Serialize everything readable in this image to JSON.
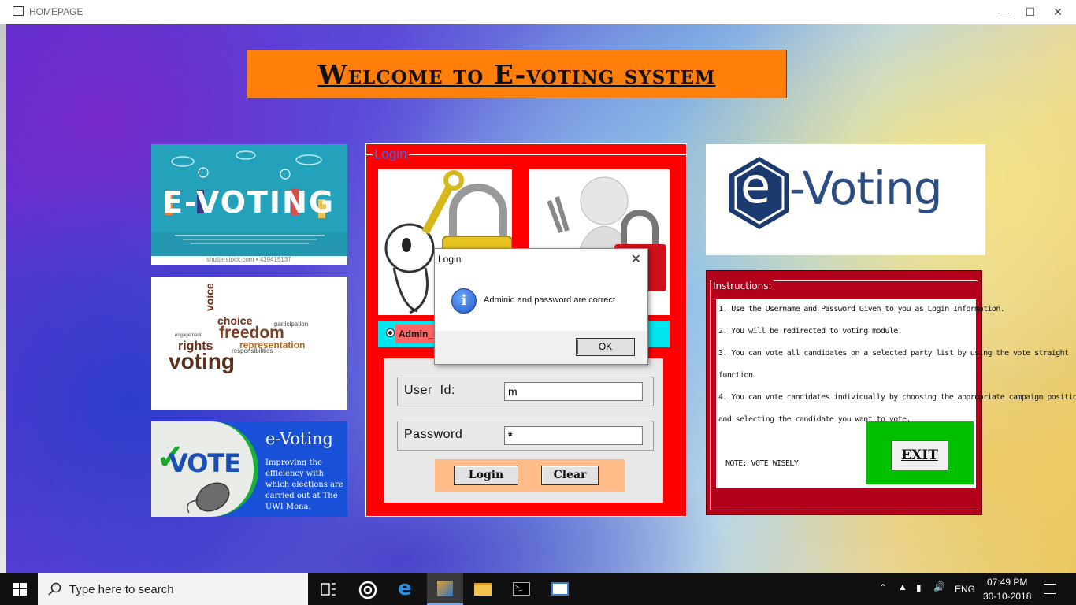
{
  "window": {
    "title": "HOMEPAGE"
  },
  "header": {
    "title": "Welcome to E-voting system"
  },
  "left_images": {
    "evoting_banner": {
      "text": "E-VOTING",
      "credit": "shutterstock.com • 439415137"
    },
    "word_cloud": {
      "words": [
        "choice",
        "freedom",
        "representation",
        "rights",
        "voting",
        "voice",
        "participation",
        "responsibilities",
        "engagement"
      ]
    },
    "vote_banner": {
      "vote": "VOTE",
      "title": "e-Voting",
      "caption": "Improving the efficiency with which elections are carried out at The UWI Mona."
    }
  },
  "login": {
    "legend": "Login",
    "radio_admin": "Admin_l",
    "radio_other_tail": "n",
    "user_id_label": "User  Id:",
    "user_id_value": "m",
    "password_label": "Password",
    "password_value": "*",
    "login_button": "Login",
    "clear_button": "Clear"
  },
  "logo": {
    "e": "e",
    "text": "-Voting"
  },
  "instructions": {
    "legend": "Instructions:",
    "lines": [
      "1. Use the Username and Password Given to you as Login Information.",
      "2. You will be redirected to voting module.",
      "3. You can vote all candidates on a selected party list by using the vote straight",
      "function.",
      "4. You can vote candidates individually by choosing the appropriate campaign position",
      "and selecting the candidate you want to vote."
    ],
    "note": "NOTE: VOTE WISELY",
    "exit_button": "EXIT"
  },
  "dialog": {
    "title": "Login",
    "message": "Adminid and password are correct",
    "ok_button": "OK",
    "icon": "info-icon"
  },
  "taskbar": {
    "search_placeholder": "Type here to search",
    "language": "ENG",
    "time": "07:49 PM",
    "date": "30-10-2018"
  },
  "colors": {
    "login_panel": "#ff0000",
    "header_bg": "#ff7f0a",
    "radio_row": "#00e5ee",
    "exit_box": "#00c000",
    "instructions_bg": "#b3001b"
  }
}
